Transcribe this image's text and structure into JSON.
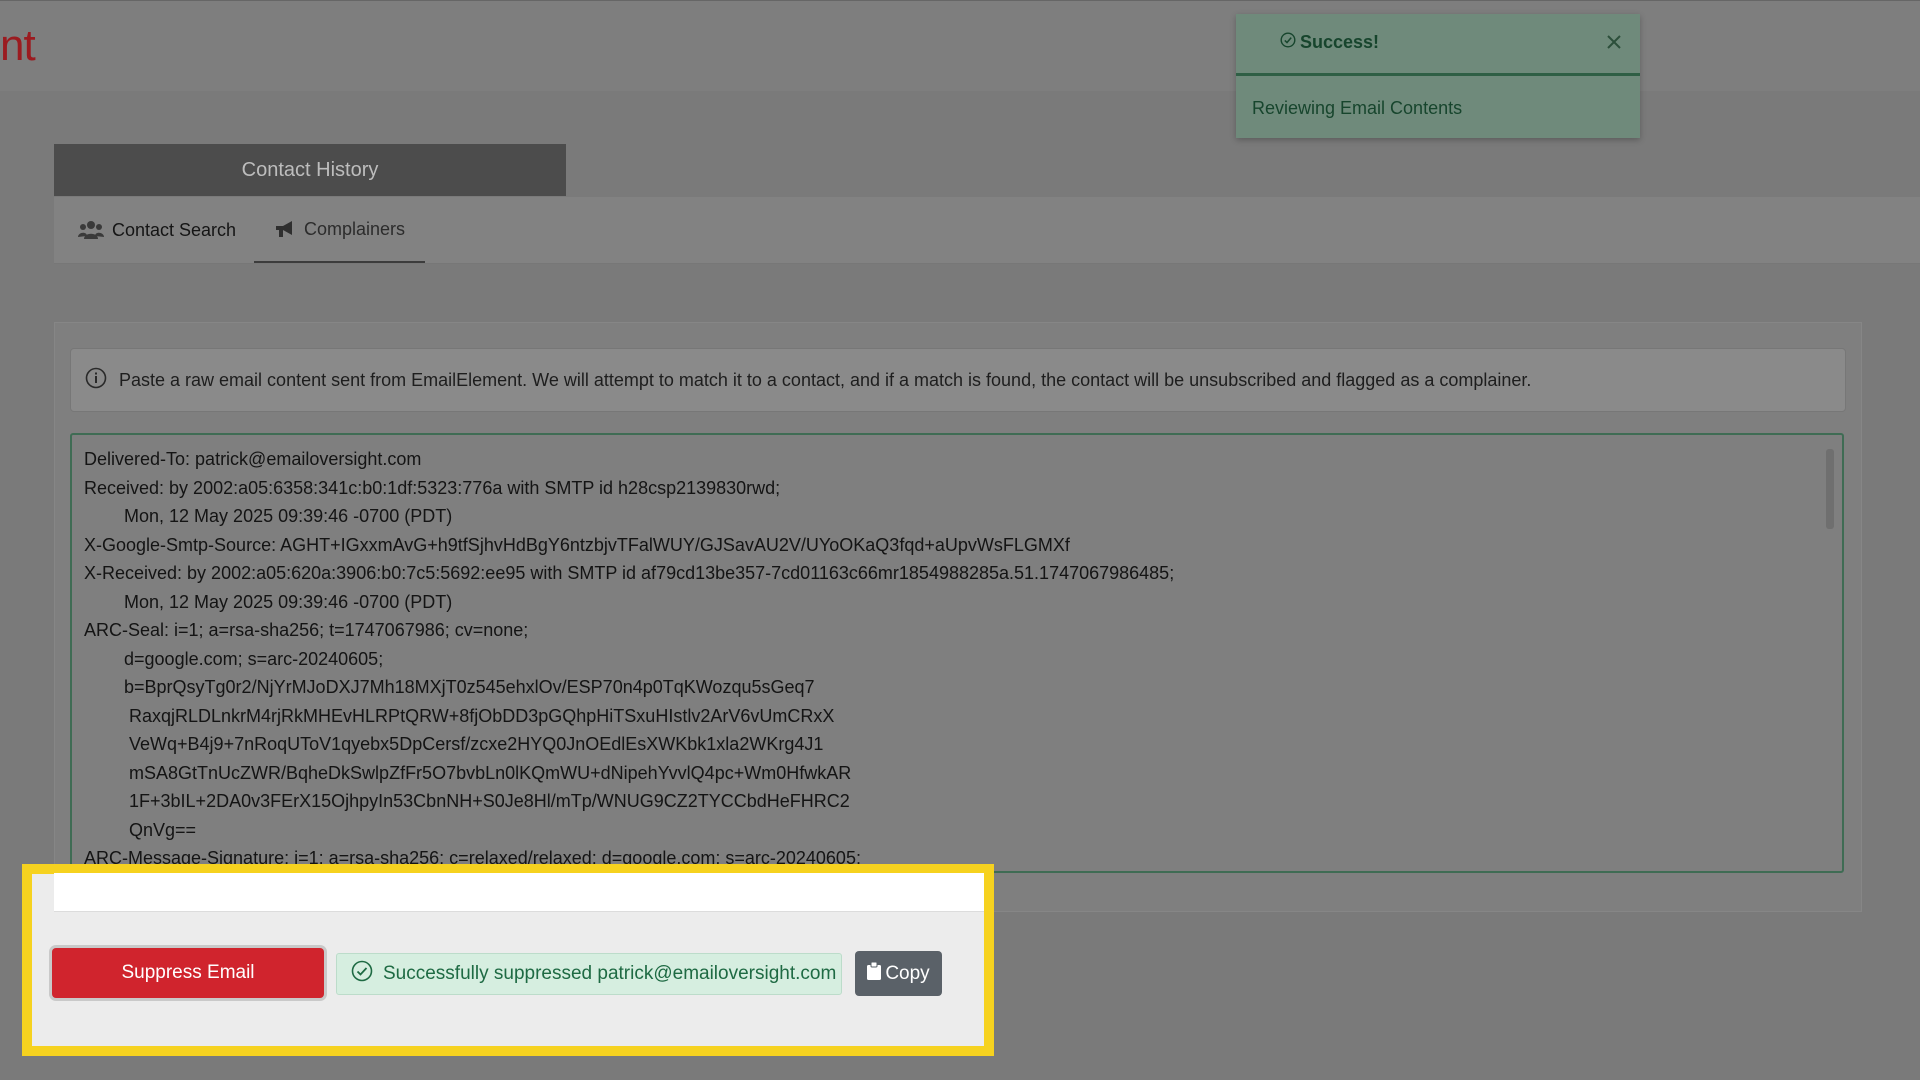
{
  "header": {
    "brand_fragment": "nt"
  },
  "toast": {
    "title": "Success!",
    "message": "Reviewing Email Contents"
  },
  "contact_history": {
    "title": "Contact History",
    "tabs": [
      {
        "label": "Contact Search",
        "icon": "users-icon"
      },
      {
        "label": "Complainers",
        "icon": "megaphone-icon"
      }
    ]
  },
  "info_alert": {
    "text": "Paste a raw email content sent from EmailElement. We will attempt to match it to a contact, and if a match is found, the contact will be unsubscribed and flagged as a complainer."
  },
  "raw_email": {
    "content": "Delivered-To: patrick@emailoversight.com\nReceived: by 2002:a05:6358:341c:b0:1df:5323:776a with SMTP id h28csp2139830rwd;\n        Mon, 12 May 2025 09:39:46 -0700 (PDT)\nX-Google-Smtp-Source: AGHT+IGxxmAvG+h9tfSjhvHdBgY6ntzbjvTFalWUY/GJSavAU2V/UYoOKaQ3fqd+aUpvWsFLGMXf\nX-Received: by 2002:a05:620a:3906:b0:7c5:5692:ee95 with SMTP id af79cd13be357-7cd01163c66mr1854988285a.51.1747067986485;\n        Mon, 12 May 2025 09:39:46 -0700 (PDT)\nARC-Seal: i=1; a=rsa-sha256; t=1747067986; cv=none;\n        d=google.com; s=arc-20240605;\n        b=BprQsyTg0r2/NjYrMJoDXJ7Mh18MXjT0z545ehxlOv/ESP70n4p0TqKWozqu5sGeq7\n         RaxqjRLDLnkrM4rjRkMHEvHLRPtQRW+8fjObDD3pGQhpHiTSxuHIstlv2ArV6vUmCRxX\n         VeWq+B4j9+7nRoqUToV1qyebx5DpCersf/zcxe2HYQ0JnOEdlEsXWKbk1xla2WKrg4J1\n         mSA8GtTnUcZWR/BqheDkSwlpZfFr5O7bvbLn0lKQmWU+dNipehYvvlQ4pc+Wm0HfwkAR\n         1F+3bIL+2DA0v3FErX15OjhpyIn53CbnNH+S0Je8Hl/mTp/WNUG9CZ2TYCCbdHeFHRC2\n         QnVg==\nARC-Message-Signature: i=1; a=rsa-sha256; c=relaxed/relaxed; d=google.com; s=arc-20240605;"
  },
  "actions": {
    "suppress_label": "Suppress Email",
    "success_message": "Successfully suppressed patrick@emailoversight.com",
    "copy_label": "Copy"
  },
  "colors": {
    "accent_red": "#d0242d",
    "success_green": "#1e6a43",
    "highlight_yellow": "#f6d21f",
    "copy_gray": "#5a6168"
  }
}
